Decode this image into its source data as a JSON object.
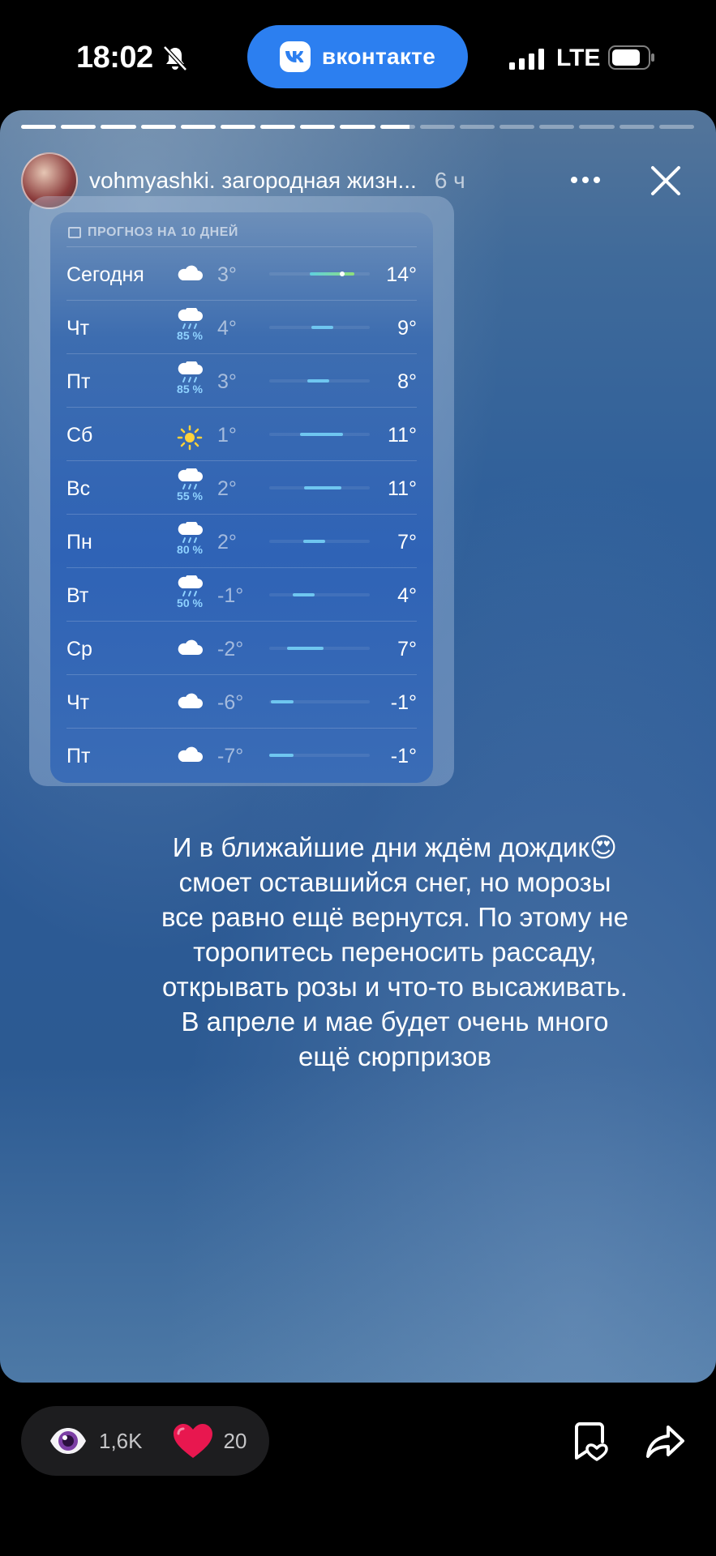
{
  "status_bar": {
    "time": "18:02",
    "vk_pill_label": "вконтакте",
    "network": "LTE"
  },
  "story": {
    "progress": {
      "total_segments": 17,
      "current_segment": 10,
      "current_fraction": 0.84
    },
    "channel_name": "vohmyashki. загородная жизн...",
    "post_age": "6 ч",
    "weather": {
      "title": "ПРОГНОЗ НА 10 ДНЕЙ",
      "days": [
        {
          "day": "Сегодня",
          "icon": "cloud-icon",
          "precip": "",
          "min": "3°",
          "max": "14°",
          "bar_from": 0.4,
          "bar_to": 0.85,
          "now": 0.7
        },
        {
          "day": "Чт",
          "icon": "cloud-rain-icon",
          "precip": "85 %",
          "min": "4°",
          "max": "9°",
          "bar_from": 0.42,
          "bar_to": 0.64
        },
        {
          "day": "Пт",
          "icon": "cloud-rain-icon",
          "precip": "85 %",
          "min": "3°",
          "max": "8°",
          "bar_from": 0.38,
          "bar_to": 0.6
        },
        {
          "day": "Сб",
          "icon": "sun-icon",
          "precip": "",
          "min": "1°",
          "max": "11°",
          "bar_from": 0.31,
          "bar_to": 0.73
        },
        {
          "day": "Вс",
          "icon": "cloud-rain-icon",
          "precip": "55 %",
          "min": "2°",
          "max": "11°",
          "bar_from": 0.35,
          "bar_to": 0.72
        },
        {
          "day": "Пн",
          "icon": "cloud-rain-icon",
          "precip": "80 %",
          "min": "2°",
          "max": "7°",
          "bar_from": 0.34,
          "bar_to": 0.56
        },
        {
          "day": "Вт",
          "icon": "cloud-rain-icon",
          "precip": "50 %",
          "min": "-1°",
          "max": "4°",
          "bar_from": 0.23,
          "bar_to": 0.45
        },
        {
          "day": "Ср",
          "icon": "cloud-icon",
          "precip": "",
          "min": "-2°",
          "max": "7°",
          "bar_from": 0.18,
          "bar_to": 0.54
        },
        {
          "day": "Чт",
          "icon": "cloud-icon",
          "precip": "",
          "min": "-6°",
          "max": "-1°",
          "bar_from": 0.02,
          "bar_to": 0.24
        },
        {
          "day": "Пт",
          "icon": "cloud-icon",
          "precip": "",
          "min": "-7°",
          "max": "-1°",
          "bar_from": 0.0,
          "bar_to": 0.24
        }
      ]
    },
    "caption_lines": [
      "И в ближайшие дни ждём дождик😍",
      "смоет оставшийся снег, но морозы",
      "все равно ещё вернутся. По этому не",
      "торопитесь переносить рассаду,",
      "открывать розы и что-то высаживать.",
      "В апреле и мае будет очень много",
      "ещё сюрпризов"
    ]
  },
  "bottom_bar": {
    "views": "1,6K",
    "likes": "20"
  }
}
